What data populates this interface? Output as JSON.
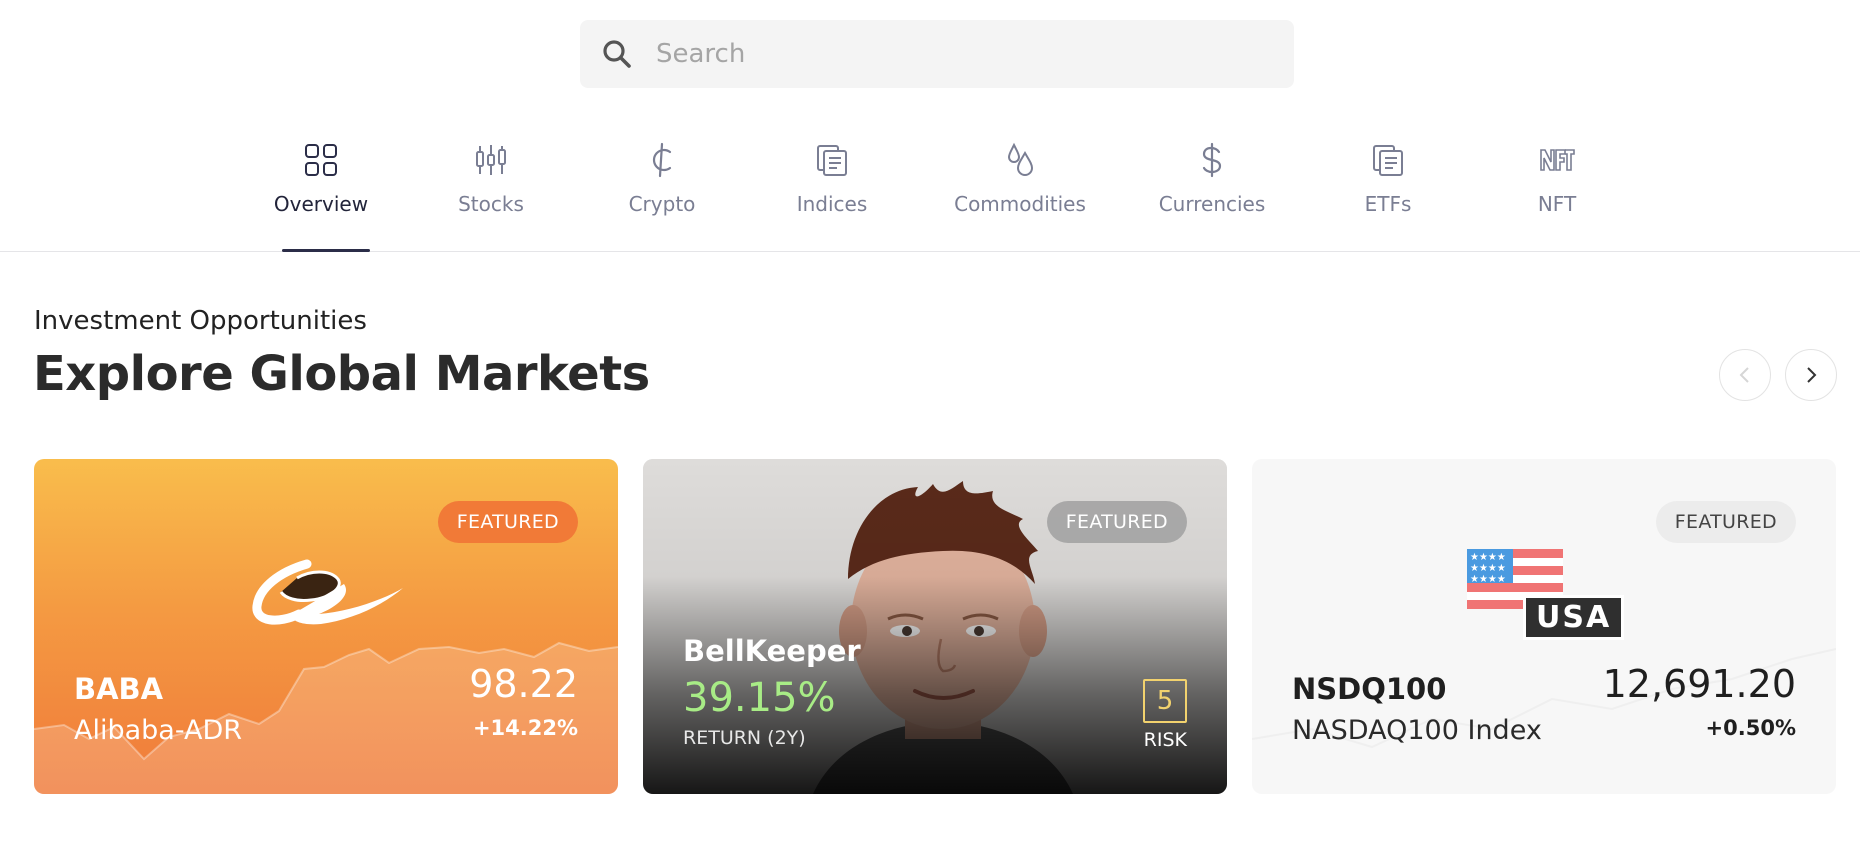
{
  "search": {
    "placeholder": "Search",
    "value": ""
  },
  "tabs": [
    {
      "label": "Overview",
      "icon": "grid-icon",
      "active": true
    },
    {
      "label": "Stocks",
      "icon": "candlestick-icon"
    },
    {
      "label": "Crypto",
      "icon": "crypto-icon"
    },
    {
      "label": "Indices",
      "icon": "indices-icon"
    },
    {
      "label": "Commodities",
      "icon": "drops-icon"
    },
    {
      "label": "Currencies",
      "icon": "dollar-icon"
    },
    {
      "label": "ETFs",
      "icon": "etf-icon"
    },
    {
      "label": "NFT",
      "icon": "nft-icon"
    }
  ],
  "section": {
    "eyebrow": "Investment Opportunities",
    "title": "Explore Global Markets"
  },
  "cards": [
    {
      "badge": "FEATURED",
      "symbol": "BABA",
      "name": "Alibaba-ADR",
      "price": "98.22",
      "change": "+14.22%",
      "logo": "alibaba-logo"
    },
    {
      "badge": "FEATURED",
      "name": "BellKeeper",
      "return": "39.15%",
      "return_label": "RETURN (2Y)",
      "risk": "5",
      "risk_label": "RISK",
      "image": "trader-photo"
    },
    {
      "badge": "FEATURED",
      "symbol": "NSDQ100",
      "name": "NASDAQ100 Index",
      "price": "12,691.20",
      "change": "+0.50%",
      "flag_label": "USA",
      "logo": "usa-flag-icon"
    }
  ],
  "colors": {
    "accent": "#2b2d48",
    "tab_inactive": "#7a7e93",
    "baba_gradient_top": "#f9bd4c",
    "baba_gradient_bottom": "#f07a3a",
    "return_green": "#a8ec86",
    "risk_yellow": "#f2d26e"
  }
}
